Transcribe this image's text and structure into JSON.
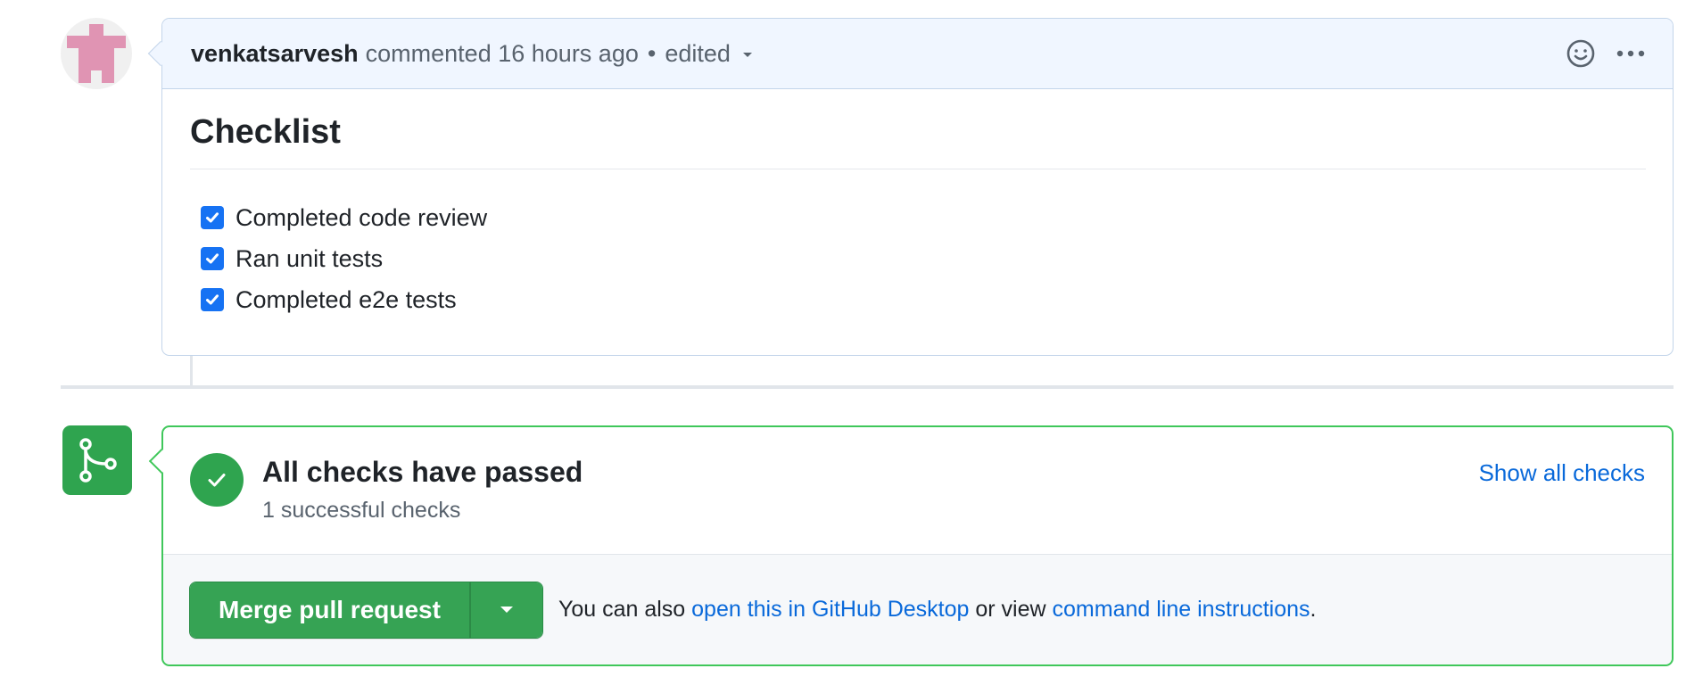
{
  "comment": {
    "author": "venkatsarvesh",
    "action": "commented",
    "timestamp": "16 hours ago",
    "separator": "•",
    "edited_label": "edited",
    "avatar_icon": "identicon-avatar",
    "actions": [
      {
        "name": "add-reaction",
        "icon": "smiley-icon"
      },
      {
        "name": "more-options",
        "icon": "kebab-horizontal-icon"
      }
    ],
    "body": {
      "heading": "Checklist",
      "tasks": [
        {
          "label": "Completed code review",
          "checked": true
        },
        {
          "label": "Ran unit tests",
          "checked": true
        },
        {
          "label": "Completed e2e tests",
          "checked": true
        }
      ]
    }
  },
  "merge": {
    "icon": "git-merge-icon",
    "status_icon": "check-circle-icon",
    "status_title": "All checks have passed",
    "status_subtitle": "1 successful checks",
    "show_all_link": "Show all checks",
    "merge_button_label": "Merge pull request",
    "alt_prefix": "You can also ",
    "alt_link_desktop": "open this in GitHub Desktop",
    "alt_middle": " or view ",
    "alt_link_cli": "command line instructions",
    "alt_suffix": "."
  },
  "colors": {
    "accent_link": "#0969da",
    "success_green": "#2fa44f",
    "checkbox_blue": "#1672f3",
    "comment_header_bg": "#f0f6ff",
    "avatar_pink": "#e094b3"
  }
}
